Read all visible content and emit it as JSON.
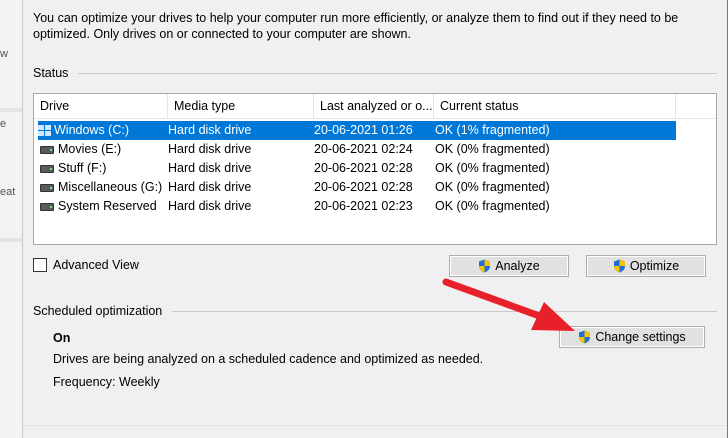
{
  "background_fragments": [
    "w",
    "e",
    "eat"
  ],
  "intro_text": "You can optimize your drives to help your computer run more efficiently, or analyze them to find out if they need to be optimized. Only drives on or connected to your computer are shown.",
  "status_label": "Status",
  "table": {
    "columns": [
      "Drive",
      "Media type",
      "Last analyzed or o...",
      "Current status"
    ],
    "rows": [
      {
        "drive": "Windows (C:)",
        "media": "Hard disk drive",
        "last": "20-06-2021 01:26",
        "status": "OK (1% fragmented)",
        "icon": "windows-drive-icon",
        "selected": true
      },
      {
        "drive": "Movies (E:)",
        "media": "Hard disk drive",
        "last": "20-06-2021 02:24",
        "status": "OK (0% fragmented)",
        "icon": "hard-drive-icon",
        "selected": false
      },
      {
        "drive": "Stuff (F:)",
        "media": "Hard disk drive",
        "last": "20-06-2021 02:28",
        "status": "OK (0% fragmented)",
        "icon": "hard-drive-icon",
        "selected": false
      },
      {
        "drive": "Miscellaneous (G:)",
        "media": "Hard disk drive",
        "last": "20-06-2021 02:28",
        "status": "OK (0% fragmented)",
        "icon": "hard-drive-icon",
        "selected": false
      },
      {
        "drive": "System Reserved",
        "media": "Hard disk drive",
        "last": "20-06-2021 02:23",
        "status": "OK (0% fragmented)",
        "icon": "hard-drive-icon",
        "selected": false
      }
    ]
  },
  "advanced_view": {
    "label": "Advanced View",
    "checked": false
  },
  "buttons": {
    "analyze": "Analyze",
    "optimize": "Optimize",
    "change_settings": "Change settings"
  },
  "scheduled": {
    "label": "Scheduled optimization",
    "state": "On",
    "description": "Drives are being analyzed on a scheduled cadence and optimized as needed.",
    "frequency": "Frequency: Weekly"
  },
  "colors": {
    "selection": "#0078d7",
    "annotation_arrow": "#e8202a",
    "shield_blue": "#1e6fd9",
    "shield_yellow": "#f5c400"
  }
}
